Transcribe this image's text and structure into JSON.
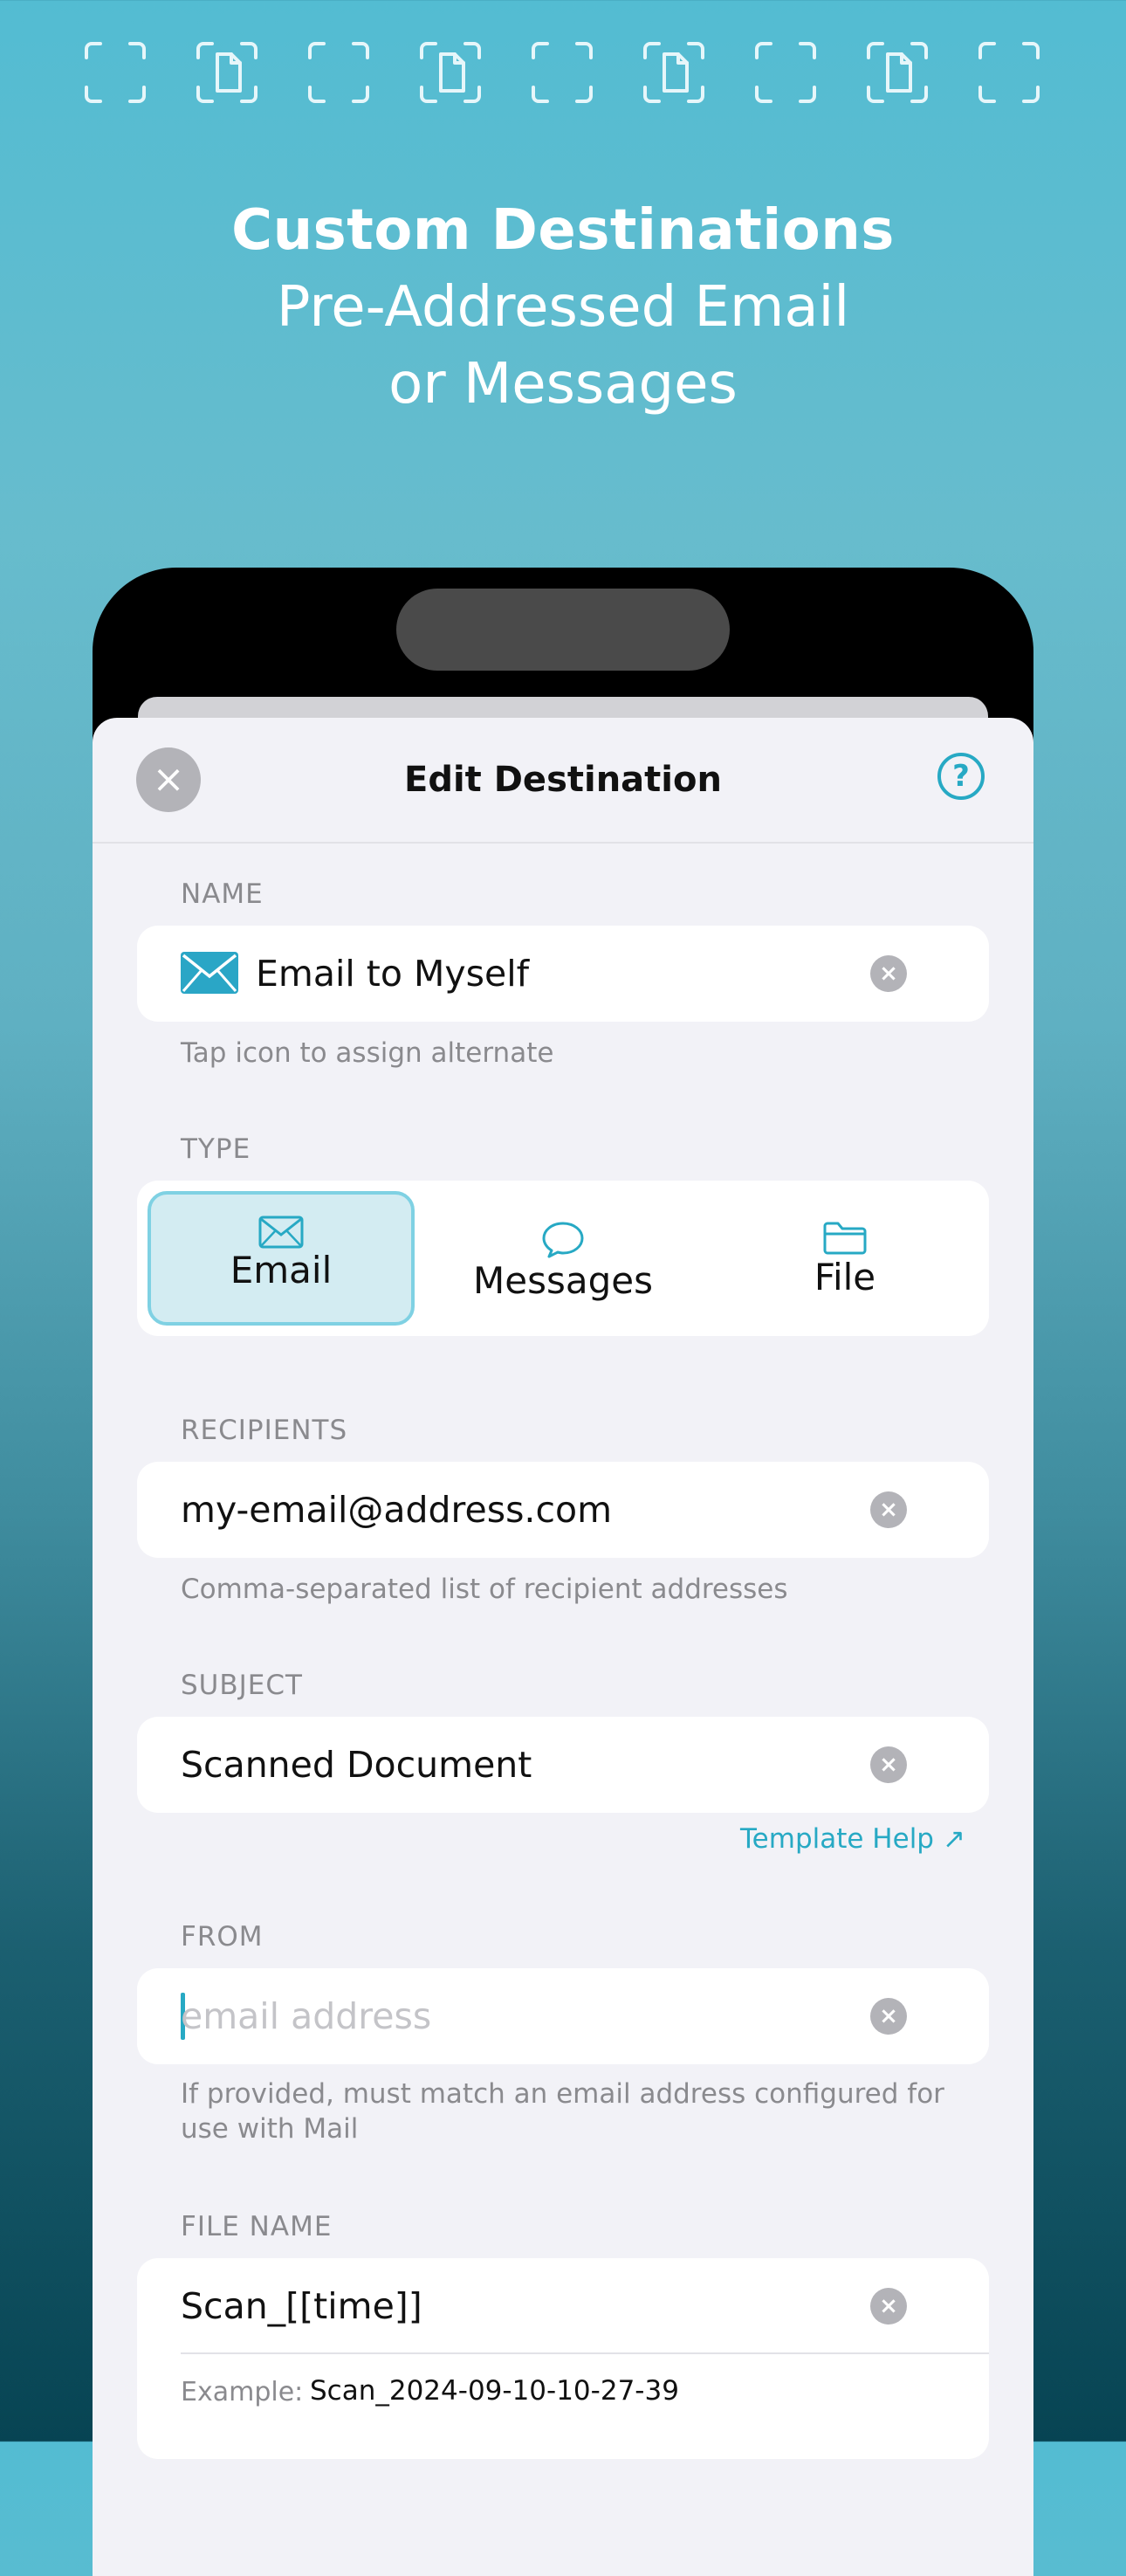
{
  "hero": {
    "title": "Custom Destinations",
    "subtitle_line1": "Pre-Addressed Email",
    "subtitle_line2": "or Messages"
  },
  "decorations": [
    "scan-frame-icon",
    "scan-document-icon",
    "scan-frame-icon",
    "scan-document-icon",
    "scan-frame-icon",
    "scan-document-icon",
    "scan-frame-icon",
    "scan-document-icon",
    "scan-frame-icon"
  ],
  "nav": {
    "close_icon": "×",
    "title": "Edit Destination",
    "help_icon": "?"
  },
  "name_section": {
    "label": "NAME",
    "value": "Email to Myself",
    "icon": "envelope-icon",
    "footnote": "Tap icon to assign alternate"
  },
  "type_section": {
    "label": "TYPE",
    "options": [
      {
        "label": "Email",
        "icon": "envelope-icon",
        "selected": true
      },
      {
        "label": "Messages",
        "icon": "speech-bubble-icon",
        "selected": false
      },
      {
        "label": "File",
        "icon": "folder-icon",
        "selected": false
      }
    ]
  },
  "recipients_section": {
    "label": "RECIPIENTS",
    "value": "my-email@address.com",
    "footnote": "Comma-separated list of recipient addresses"
  },
  "subject_section": {
    "label": "SUBJECT",
    "value": "Scanned Document",
    "template_help": "Template Help ↗"
  },
  "from_section": {
    "label": "FROM",
    "placeholder": "email address",
    "footnote": "If provided, must match an email address configured for use with Mail"
  },
  "filename_section": {
    "label": "FILE NAME",
    "value": "Scan_[[time]]",
    "example_label": "Example:",
    "example_value": "Scan_2024-09-10-10-27-39"
  },
  "clear_icon": "×",
  "colors": {
    "accent": "#27a9c4",
    "selected_fill": "#d3ecf2",
    "sheet_background": "#f2f2f7",
    "secondary_text": "#8a8a8e"
  }
}
